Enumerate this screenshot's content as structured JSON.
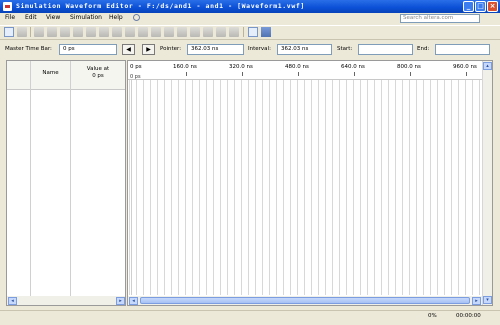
{
  "window": {
    "title": "Simulation Waveform Editor - F:/ds/and1 - and1 - [Waveform1.vwf]"
  },
  "menu": {
    "items": [
      "File",
      "Edit",
      "View",
      "Simulation",
      "Help"
    ]
  },
  "search": {
    "placeholder": "Search altera.com"
  },
  "timebar": {
    "master_label": "Master Time Bar:",
    "master_value": "0 ps",
    "pointer_label": "Pointer:",
    "pointer_value": "362.03 ns",
    "interval_label": "Interval:",
    "interval_value": "362.03 ns",
    "start_label": "Start:",
    "start_value": "",
    "end_label": "End:",
    "end_value": "",
    "prev_icon": "left-arrow-icon",
    "next_icon": "right-arrow-icon"
  },
  "signal_list": {
    "col_name": "Name",
    "col_value_line1": "Value at",
    "col_value_line2": "0 ps"
  },
  "ruler": {
    "labels": [
      "0 ps",
      "160.0 ns",
      "320.0 ns",
      "480.0 ns",
      "640.0 ns",
      "800.0 ns",
      "960.0 ns"
    ],
    "marker": "0 ps"
  },
  "status": {
    "progress": "0%",
    "elapsed": "00:00:00"
  },
  "colors": {
    "titlebar": "#0a4fd6",
    "scroll_thumb": "#a6c2f4"
  }
}
